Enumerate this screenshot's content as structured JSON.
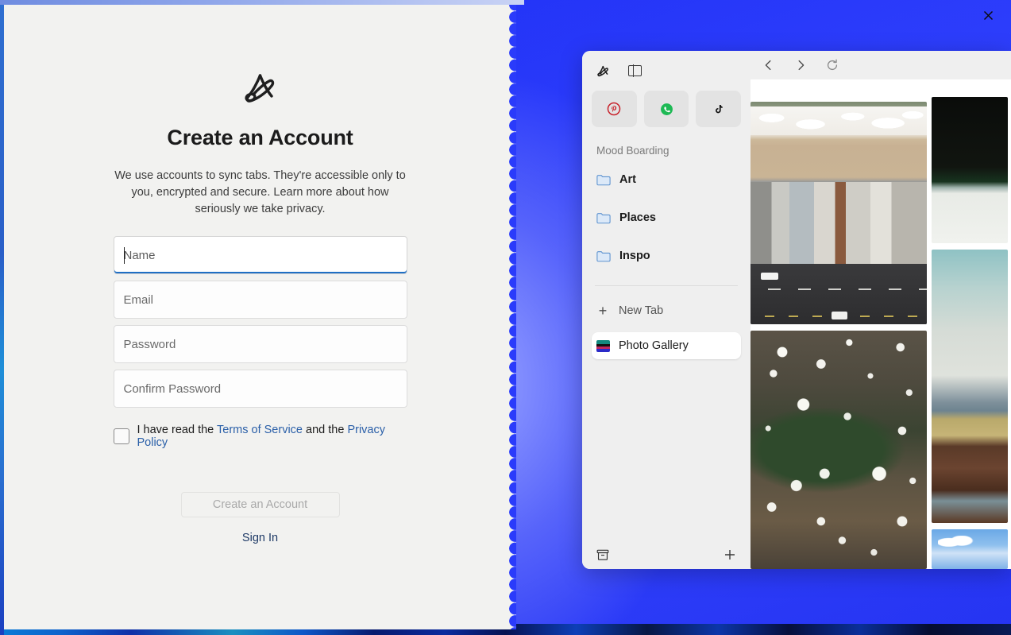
{
  "window": {
    "close_label": "✕"
  },
  "signup": {
    "logo_icon": "arc-logo-icon",
    "title": "Create an Account",
    "subtitle": "We use accounts to sync tabs. They're accessible only to you, encrypted and secure. Learn more about how seriously we take privacy.",
    "fields": [
      {
        "name": "name",
        "placeholder": "Name",
        "value": "",
        "focused": true
      },
      {
        "name": "email",
        "placeholder": "Email",
        "value": "",
        "focused": false
      },
      {
        "name": "password",
        "placeholder": "Password",
        "value": "",
        "focused": false
      },
      {
        "name": "confirm_password",
        "placeholder": "Confirm Password",
        "value": "",
        "focused": false
      }
    ],
    "consent": {
      "checked": false,
      "prefix": "I have read the ",
      "terms_link": "Terms of Service",
      "middle": " and the ",
      "privacy_link": "Privacy Policy"
    },
    "submit_label": "Create an Account",
    "signin_label": "Sign In",
    "accent_color": "#1f6fc4",
    "link_color": "#2a5fa8"
  },
  "browser": {
    "toolbar": {
      "arc_logo_icon": "arc-mini-logo-icon",
      "panel_toggle_icon": "sidebar-panel-icon",
      "back_icon": "arrow-left-icon",
      "forward_icon": "arrow-right-icon",
      "reload_icon": "reload-icon"
    },
    "pinned": [
      {
        "name": "pinterest",
        "icon": "pinterest-icon",
        "color": "#c8232c"
      },
      {
        "name": "whatsapp",
        "icon": "whatsapp-icon",
        "color": "#1db954"
      },
      {
        "name": "tiktok",
        "icon": "tiktok-icon",
        "color": "#111111"
      }
    ],
    "space_title": "Mood Boarding",
    "folders": [
      {
        "label": "Art",
        "icon": "folder-icon"
      },
      {
        "label": "Places",
        "icon": "folder-icon"
      },
      {
        "label": "Inspo",
        "icon": "folder-icon"
      }
    ],
    "new_tab_label": "New Tab",
    "new_tab_icon": "plus-icon",
    "active_tab": {
      "label": "Photo Gallery",
      "icon": "photo-gallery-favicon"
    },
    "bottom": {
      "archive_icon": "archive-icon",
      "add_icon": "plus-icon"
    },
    "gallery": {
      "photos": [
        {
          "name": "aerial-beach-houses",
          "alt": "Aerial view of beach houses along a coastal road"
        },
        {
          "name": "atrium-globe-lights",
          "alt": "Atrium interior with hanging globe lights and trees"
        },
        {
          "name": "dark-snow-landscape",
          "alt": "Dark trees above a snowy white field"
        },
        {
          "name": "desert-deck-view",
          "alt": "Desert mountain view from a wooden deck"
        },
        {
          "name": "blue-sky-clouds",
          "alt": "Blue sky with white clouds"
        }
      ]
    }
  }
}
